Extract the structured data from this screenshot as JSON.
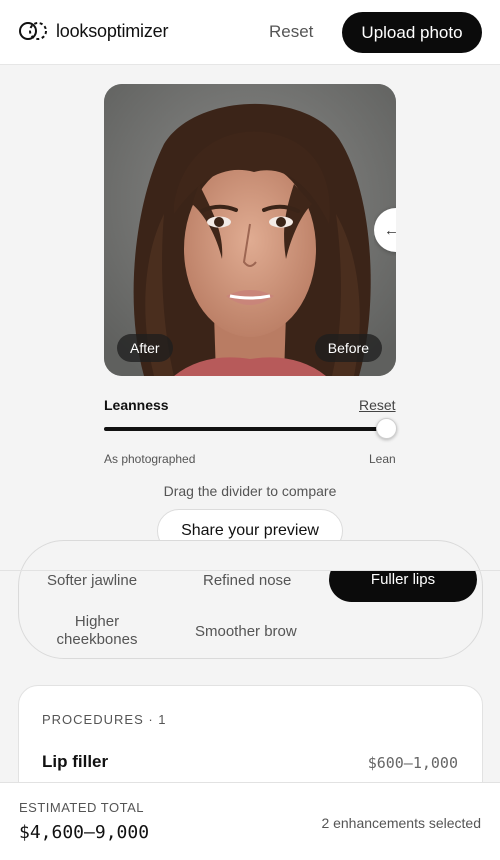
{
  "header": {
    "brand": "looksoptimizer",
    "logo_icon": "double-circle-logo",
    "reset_label": "Reset",
    "upload_label": "Upload photo"
  },
  "preview": {
    "after_label": "After",
    "before_label": "Before",
    "divider_icon": "left-arrow-icon"
  },
  "slider": {
    "label": "Leanness",
    "reset_label": "Reset",
    "value_fraction": 1.0,
    "min_label": "As photographed",
    "max_label": "Lean"
  },
  "hint": "Drag the divider to compare",
  "share_label": "Share your preview",
  "enhancements": [
    {
      "label": "Softer jawline",
      "selected": false
    },
    {
      "label": "Refined nose",
      "selected": false
    },
    {
      "label": "Fuller lips",
      "selected": true
    },
    {
      "label": "Higher cheekbones",
      "selected": false
    },
    {
      "label": "Smoother brow",
      "selected": false
    }
  ],
  "procedures": {
    "heading": "PROCEDURES · 1",
    "items": [
      {
        "name": "Lip filler",
        "price": "$600–1,000"
      }
    ]
  },
  "footer": {
    "estimate_label": "ESTIMATED TOTAL",
    "estimate_value": "$4,600–9,000",
    "selected_text": "2 enhancements selected"
  },
  "colors": {
    "accent": "#0b0b0b",
    "background": "#f4f4f4"
  }
}
